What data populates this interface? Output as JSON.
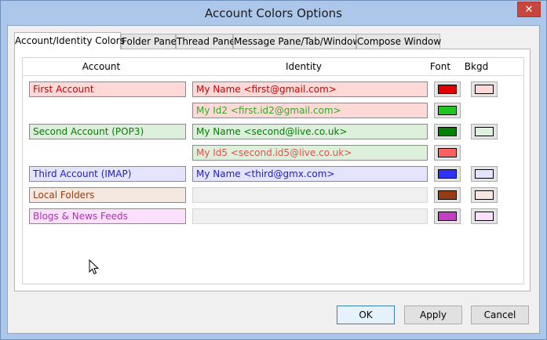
{
  "window": {
    "title": "Account Colors Options",
    "close_glyph": "✕"
  },
  "tabs": [
    {
      "label": "Account/Identity Colors",
      "active": true
    },
    {
      "label": "Folder Pane"
    },
    {
      "label": "Thread Pane"
    },
    {
      "label": "Message Pane/Tab/Window"
    },
    {
      "label": "Compose Window"
    }
  ],
  "columns": {
    "account": "Account",
    "identity": "Identity",
    "font": "Font",
    "bkgd": "Bkgd"
  },
  "rows": [
    {
      "account": "First Account",
      "identity": "My Name <first@gmail.com>",
      "font": "#e00000",
      "bkgd": "#ffd8d8",
      "textColor": "#cc0000"
    },
    {
      "account": "",
      "identity": "My Id2 <first.id2@gmail.com>",
      "font": "#22c422",
      "bkgd": "#ffd8d8",
      "textColor": "#33aa22"
    },
    {
      "account": "Second Account (POP3)",
      "identity": "My Name <second@live.co.uk>",
      "font": "#008000",
      "bkgd": "#dcf0dc",
      "textColor": "#008000"
    },
    {
      "account": "",
      "identity": "My  Id5 <second.id5@live.co.uk>",
      "font": "#ff6060",
      "bkgd": "#dcf0dc",
      "textColor": "#e05050"
    },
    {
      "account": "Third Account (IMAP)",
      "identity": "My Name <third@gmx.com>",
      "font": "#3030ff",
      "bkgd": "#e4e4ff",
      "textColor": "#2020c0"
    },
    {
      "account": "Local Folders",
      "identity": "",
      "font": "#963c14",
      "bkgd": "#f5e8e0",
      "textColor": "#963c14"
    },
    {
      "account": "Blogs & News Feeds",
      "identity": "",
      "font": "#c040c0",
      "bkgd": "#fae0fa",
      "textColor": "#b030b0"
    }
  ],
  "buttons": {
    "ok": "OK",
    "apply": "Apply",
    "cancel": "Cancel"
  }
}
